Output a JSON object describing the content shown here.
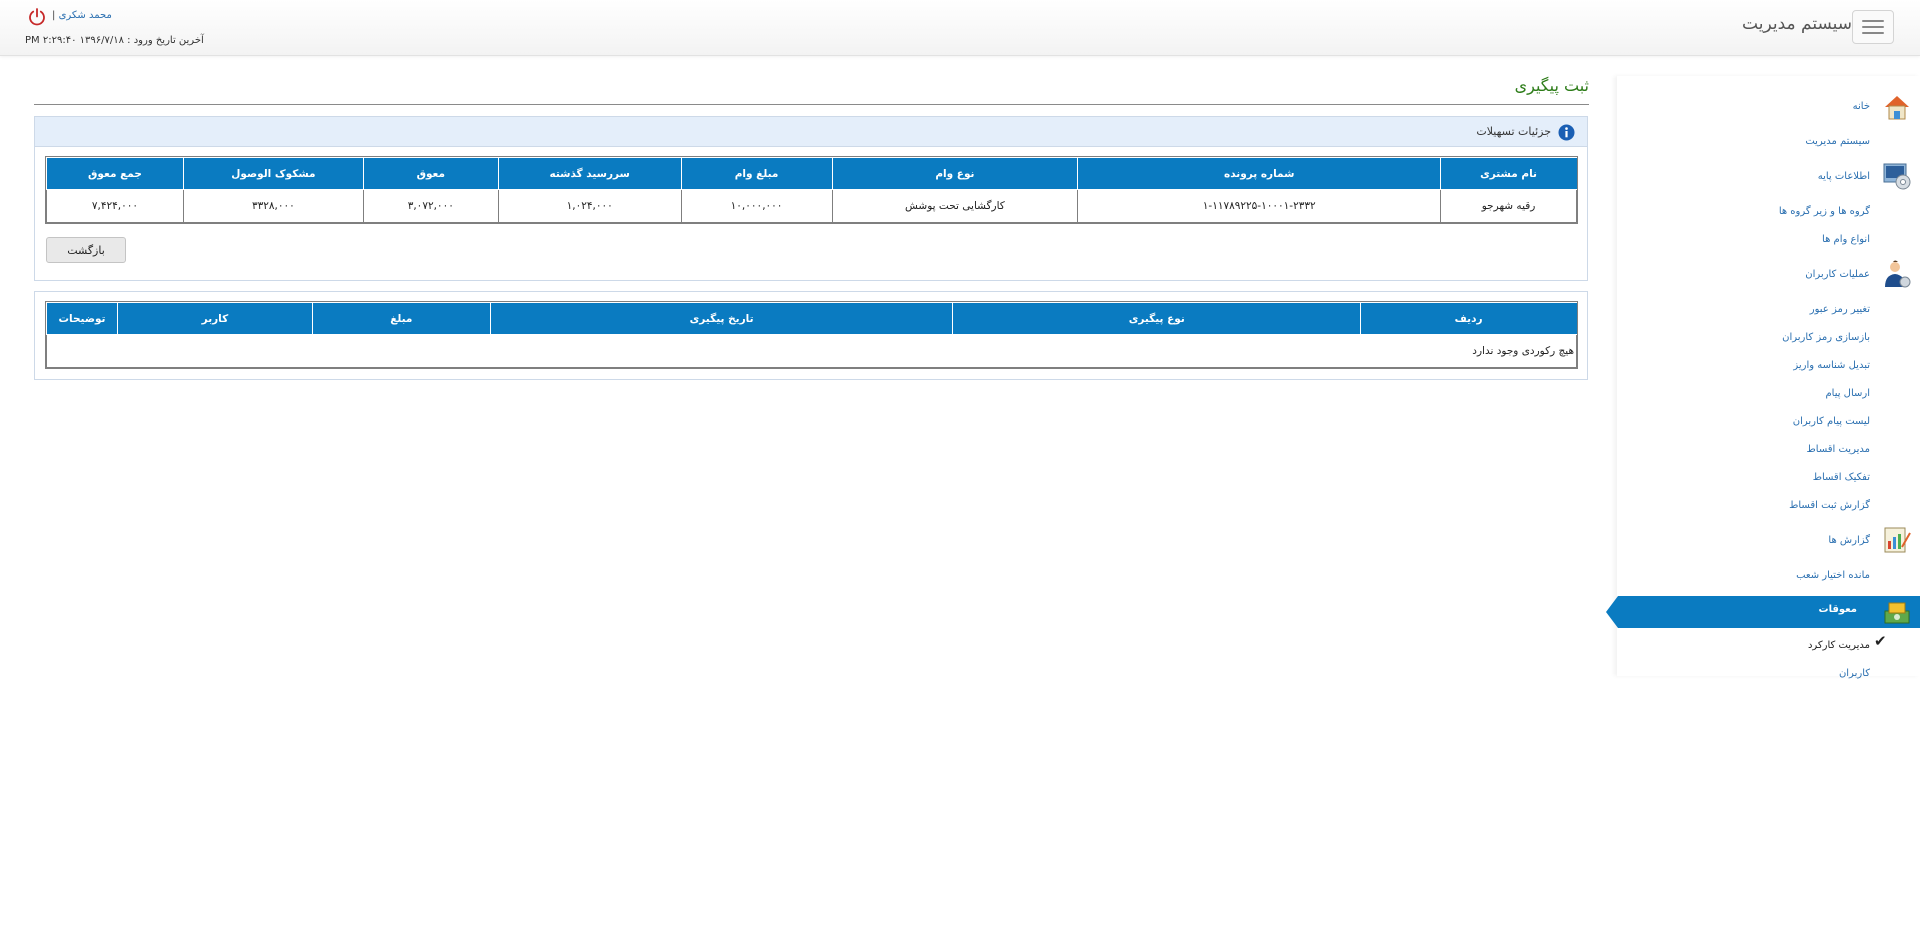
{
  "header": {
    "brand": "سیستم مدیریت",
    "user_name": "محمد شکری",
    "separator": "|",
    "last_login": "آخرین تاریخ ورود : ۱۳۹۶/۷/۱۸ ۲:۲۹:۴۰ PM"
  },
  "sidebar": {
    "items": [
      {
        "label": "خانه",
        "icon": "home-icon"
      },
      {
        "label": "سیستم مدیریت"
      },
      {
        "label": "اطلاعات پایه",
        "icon": "settings-icon"
      },
      {
        "label": "گروه ها و زیر گروه ها"
      },
      {
        "label": "انواع وام ها"
      },
      {
        "label": "عملیات کاربران",
        "icon": "user-icon"
      },
      {
        "label": "تغییر رمز عبور"
      },
      {
        "label": "بازسازی رمز کاربران"
      },
      {
        "label": "تبدیل شناسه واریز"
      },
      {
        "label": "ارسال پیام"
      },
      {
        "label": "لیست پیام کاربران"
      },
      {
        "label": "مدیریت اقساط"
      },
      {
        "label": "تفکیک اقساط"
      },
      {
        "label": "گزارش ثبت اقساط"
      },
      {
        "label": "گزارش ها",
        "icon": "report-icon"
      },
      {
        "label": "مانده اختیار شعب"
      },
      {
        "label": "معوقات",
        "icon": "money-icon",
        "active": true
      },
      {
        "label": "مدیریت کارکرد",
        "checked": true
      },
      {
        "label": "کاربران"
      }
    ],
    "colors": {
      "active": "#0a7bc1",
      "link": "#2a6fb0"
    }
  },
  "main": {
    "page_title": "ثبت پیگیری",
    "panel1": {
      "title": "جزئیات تسهیلات",
      "columns": [
        "نام مشتری",
        "شماره پرونده",
        "نوع وام",
        "مبلغ وام",
        "سررسید گذشته",
        "معوق",
        "مشکوک الوصول",
        "جمع معوق"
      ],
      "row": [
        "رقیه شهرجو",
        "۱-۱۱۷۸۹۲۲۵-۱۰۰۰۱-۲۳۳۲",
        "کارگشایی تحت پوشش",
        "۱۰,۰۰۰,۰۰۰",
        "۱,۰۲۴,۰۰۰",
        "۳,۰۷۲,۰۰۰",
        "۳۳۲۸,۰۰۰",
        "۷,۴۲۴,۰۰۰"
      ],
      "back_label": "بازگشت"
    },
    "panel2": {
      "columns": [
        "ردیف",
        "نوع پیگیری",
        "تاریخ پیگیری",
        "مبلغ",
        "کاربر",
        "توضیحات"
      ],
      "empty_text": "هیچ رکوردی وجود ندارد"
    },
    "colors": {
      "header_bg": "#0a7bc1",
      "title": "#2e7d1a",
      "panel_head": "#e4eefa"
    }
  }
}
